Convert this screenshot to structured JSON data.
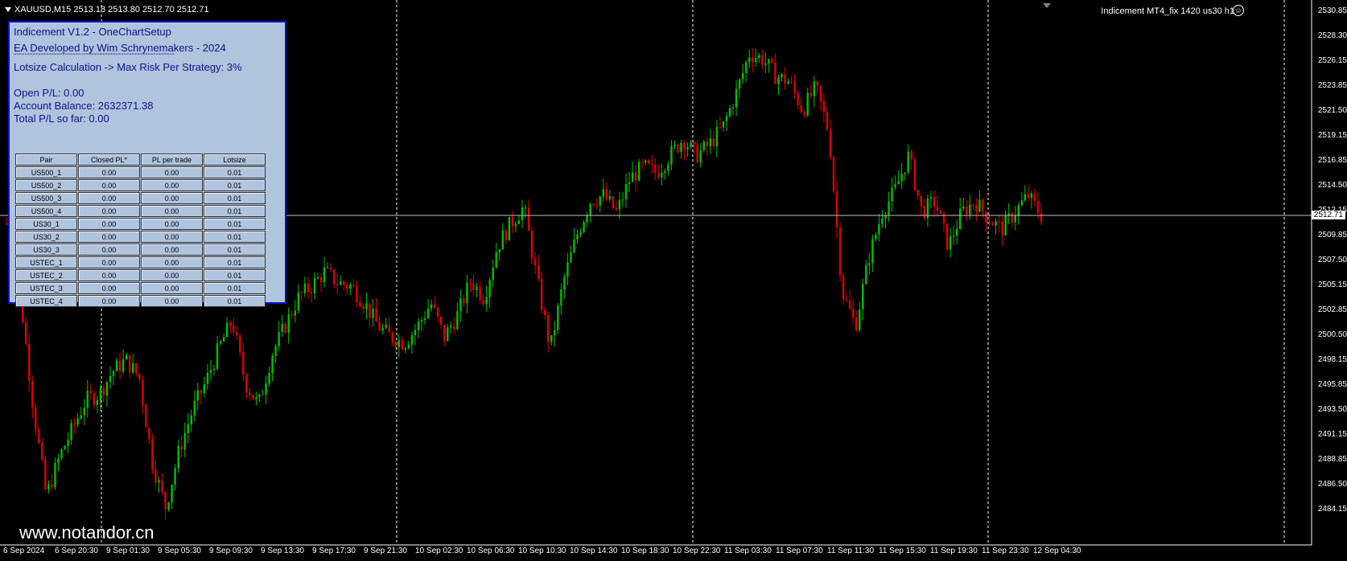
{
  "header": {
    "symbol_info": "XAUUSD,M15  2513.18 2513.80 2512.70 2512.71",
    "ea_label": "Indicement MT4_fix 1420 us30 h1"
  },
  "panel": {
    "title": "Indicement V1.2 - OneChartSetup",
    "developer": "EA Developed by Wim Schrynemakers - 2024",
    "separator": "------------------------------------------------------------",
    "lotsize_calc": "Lotsize Calculation -> Max Risk Per Strategy: 3%",
    "open_pl": "Open P/L: 0.00",
    "account_balance": "Account Balance: 2632371.38",
    "total_pl": "Total P/L so far: 0.00",
    "table": {
      "headers": [
        "Pair",
        "Closed PL*",
        "PL per trade",
        "Lotsize"
      ],
      "rows": [
        [
          "US500_1",
          "0.00",
          "0.00",
          "0.01"
        ],
        [
          "US500_2",
          "0.00",
          "0.00",
          "0.01"
        ],
        [
          "US500_3",
          "0.00",
          "0.00",
          "0.01"
        ],
        [
          "US500_4",
          "0.00",
          "0.00",
          "0.01"
        ],
        [
          "US30_1",
          "0.00",
          "0.00",
          "0.01"
        ],
        [
          "US30_2",
          "0.00",
          "0.00",
          "0.01"
        ],
        [
          "US30_3",
          "0.00",
          "0.00",
          "0.01"
        ],
        [
          "USTEC_1",
          "0.00",
          "0.00",
          "0.01"
        ],
        [
          "USTEC_2",
          "0.00",
          "0.00",
          "0.01"
        ],
        [
          "USTEC_3",
          "0.00",
          "0.00",
          "0.01"
        ],
        [
          "USTEC_4",
          "0.00",
          "0.00",
          "0.01"
        ]
      ]
    }
  },
  "watermark": "www.notandor.cn",
  "current_price": "2512.71",
  "price_axis": [
    "2530.85",
    "2528.30",
    "2526.15",
    "2523.85",
    "2521.50",
    "2519.15",
    "2516.85",
    "2514.50",
    "2512.15",
    "2509.85",
    "2507.50",
    "2505.15",
    "2502.85",
    "2500.50",
    "2498.15",
    "2495.85",
    "2493.50",
    "2491.15",
    "2488.85",
    "2486.50",
    "2484.15"
  ],
  "time_axis": [
    "6 Sep 2024",
    "6 Sep 20:30",
    "9 Sep 01:30",
    "9 Sep 05:30",
    "9 Sep 09:30",
    "9 Sep 13:30",
    "9 Sep 17:30",
    "9 Sep 21:30",
    "10 Sep 02:30",
    "10 Sep 06:30",
    "10 Sep 10:30",
    "10 Sep 14:30",
    "10 Sep 18:30",
    "10 Sep 22:30",
    "11 Sep 03:30",
    "11 Sep 07:30",
    "11 Sep 11:30",
    "11 Sep 15:30",
    "11 Sep 19:30",
    "11 Sep 23:30",
    "12 Sep 04:30"
  ],
  "colors": {
    "bull": "#00c000",
    "bear": "#e00000",
    "grid": "#ffffff",
    "panel_bg": "#b0c4de",
    "panel_text": "#10108a"
  },
  "price_path": [
    2512.0,
    2506.0,
    2496.0,
    2488.0,
    2491.5,
    2494.0,
    2496.5,
    2497.0,
    2499.0,
    2500.0,
    2498.5,
    2491.0,
    2487.0,
    2492.0,
    2495.5,
    2498.0,
    2501.0,
    2503.5,
    2498.0,
    2496.0,
    2500.5,
    2503.0,
    2505.5,
    2506.5,
    2507.8,
    2506.8,
    2506.5,
    2505.0,
    2503.0,
    2502.0,
    2501.5,
    2503.0,
    2505.0,
    2502.0,
    2504.0,
    2507.0,
    2505.5,
    2510.0,
    2512.0,
    2513.5,
    2507.0,
    2501.0,
    2507.0,
    2511.0,
    2514.0,
    2514.5,
    2513.0,
    2516.0,
    2517.0,
    2516.5,
    2518.0,
    2519.5,
    2518.0,
    2519.0,
    2520.5,
    2523.5,
    2527.0,
    2526.5,
    2525.0,
    2524.5,
    2522.0,
    2524.0,
    2520.0,
    2506.0,
    2503.0,
    2509.0,
    2513.0,
    2515.0,
    2518.0,
    2513.0,
    2514.0,
    2510.0,
    2513.0,
    2514.0,
    2512.5,
    2511.5,
    2513.0,
    2514.5,
    2512.7
  ]
}
